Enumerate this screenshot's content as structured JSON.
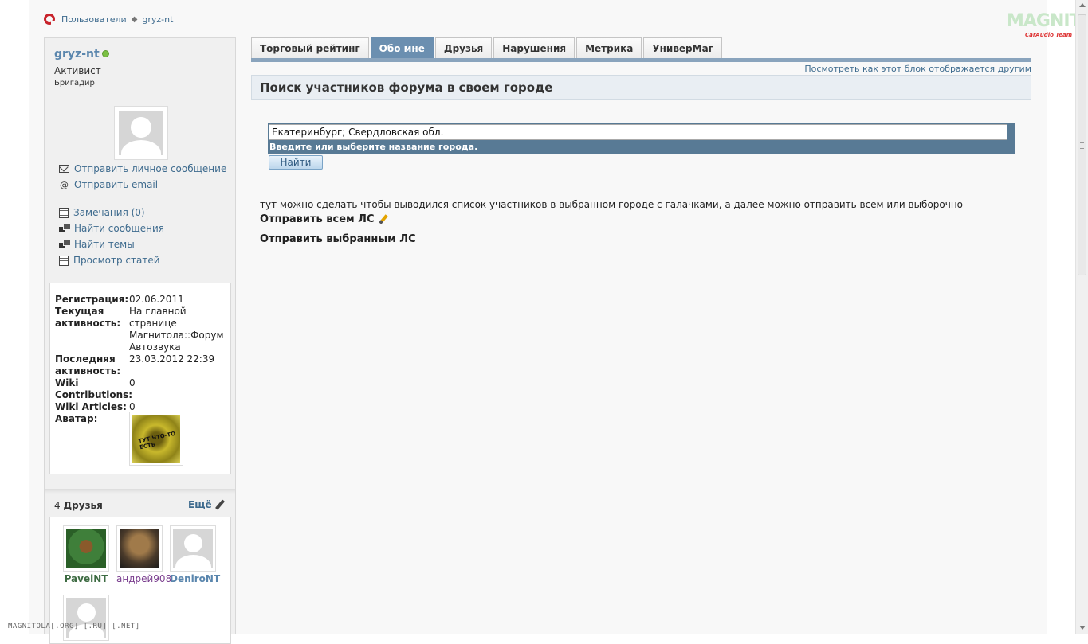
{
  "breadcrumb": {
    "items": [
      "Пользователи",
      "gryz-nt"
    ],
    "separator": "◆"
  },
  "logo": {
    "main": "MAGNITOLA",
    "sub": "CarAudio Team"
  },
  "profile": {
    "username": "gryz-nt",
    "usertitle": "Активист",
    "rank": "Бригадир",
    "actions": [
      "Отправить личное сообщение",
      "Отправить email",
      "Замечания (0)",
      "Найти сообщения",
      "Найти темы",
      "Просмотр статей"
    ],
    "stats": {
      "registration_label": "Регистрация:",
      "registration_value": "02.06.2011",
      "activity_label_1": "Текущая",
      "activity_label_2": "активность:",
      "activity_value_1": "На главной",
      "activity_value_2": "странице",
      "activity_link_1": "Магнитола::Форум",
      "activity_link_2": "Автозвука",
      "last_label_1": "Последняя",
      "last_label_2": "активность:",
      "last_value": "23.03.2012 22:39",
      "wiki_contrib_label_1": "Wiki",
      "wiki_contrib_label_2": "Contributions:",
      "wiki_contrib_value": "0",
      "wiki_articles_label": "Wiki Articles:",
      "wiki_articles_value": "0",
      "avatar_label": "Аватар:"
    },
    "friends": {
      "count": "4",
      "title": "Друзья",
      "more": "Ещё",
      "list": [
        {
          "name": "PavelNT",
          "color": "#3d6b42"
        },
        {
          "name": "андрей908",
          "color": "#7b3f8f"
        },
        {
          "name": "DeniroNT",
          "color": "#5a86ad"
        }
      ]
    }
  },
  "tabs": [
    "Торговый рейтинг",
    "Обо мне",
    "Друзья",
    "Нарушения",
    "Метрика",
    "УниверМаг"
  ],
  "active_tab": 1,
  "main": {
    "view_as": "Посмотреть как этот блок отображается другим",
    "block_title": "Поиск участников форума в своем городе",
    "search_value": "Екатеринбург; Свердловская обл.",
    "search_hint": "Введите или выберите название города.",
    "find_button": "Найти",
    "info_text": "тут можно сделать чтобы выводился список участников в выбранном городе с галачками, а далее можно отправить всем или выборочно",
    "send_all": "Отправить всем ЛС",
    "send_selected": "Отправить выбранным ЛС"
  },
  "footer": "MAGNITOLA[.ORG] [.RU] [.NET]",
  "colors": {
    "accent": "#5a86ad",
    "tab_active": "#6b8fb0",
    "search_bar": "#587a95"
  }
}
